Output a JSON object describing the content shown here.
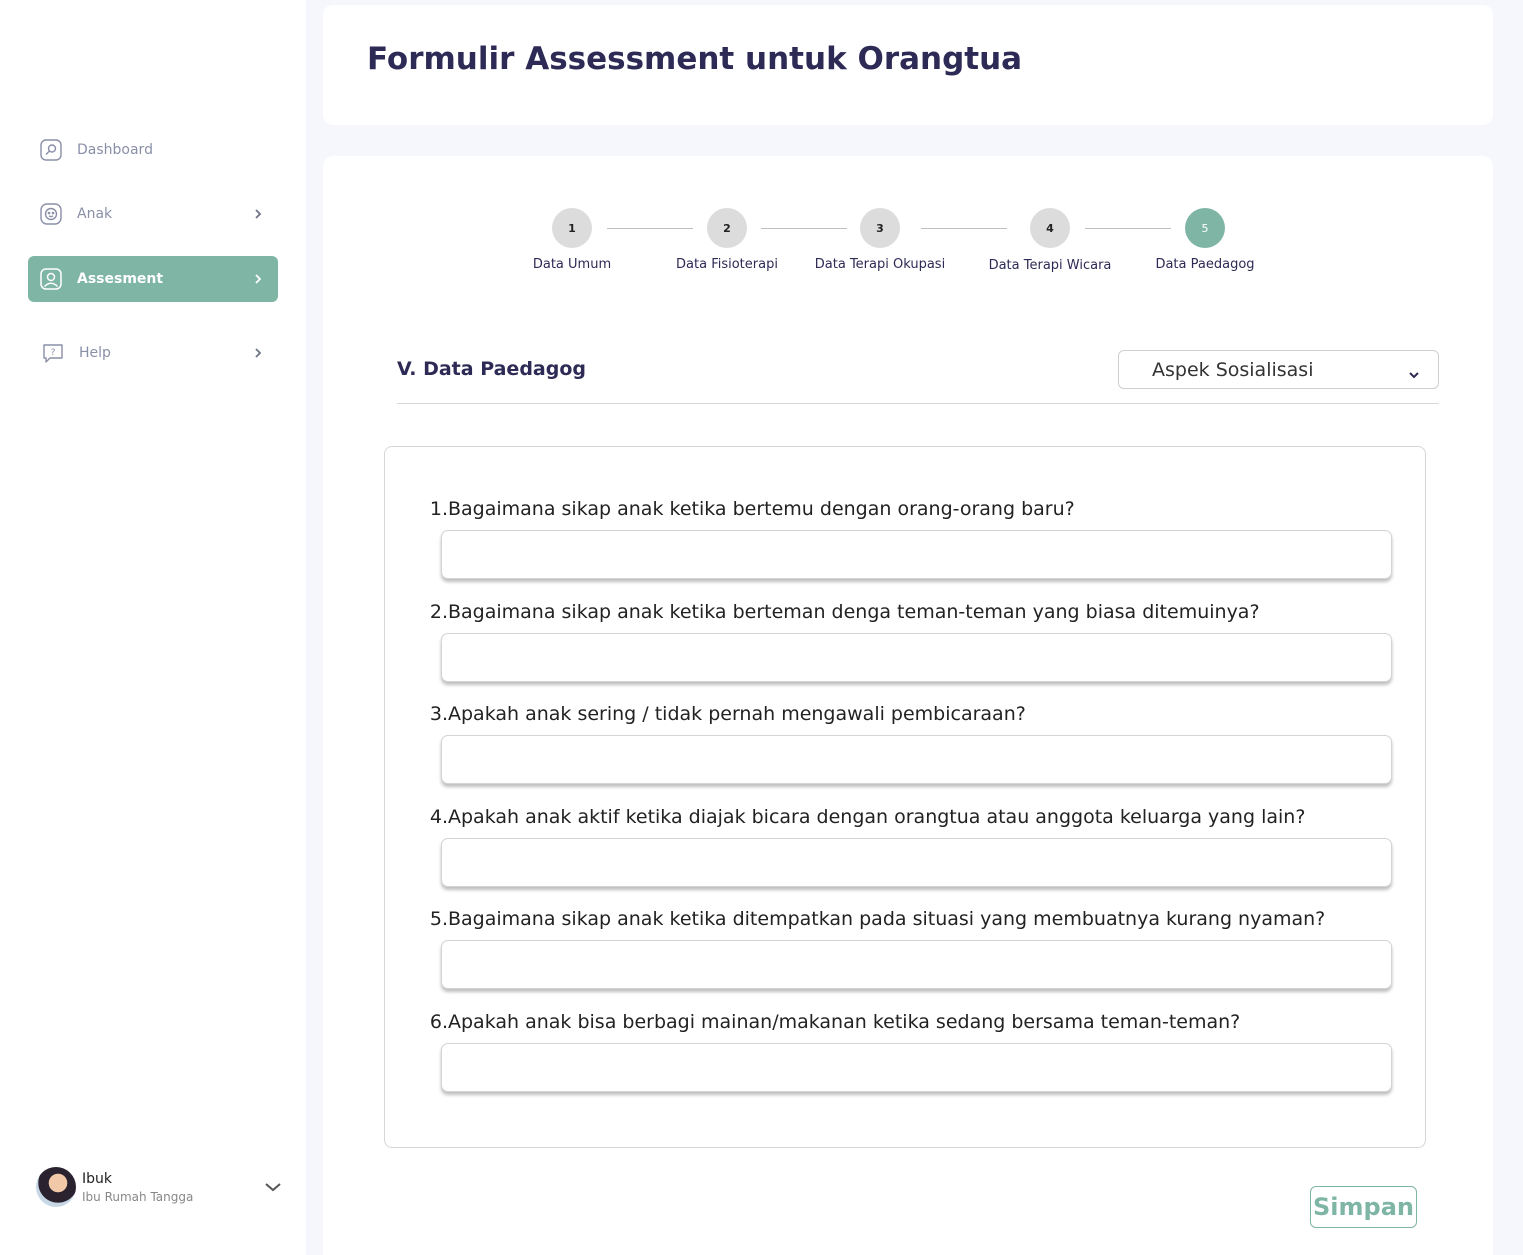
{
  "sidebar": {
    "items": [
      {
        "label": "Dashboard",
        "icon": "dashboard-icon"
      },
      {
        "label": "Anak",
        "icon": "child-face-icon"
      },
      {
        "label": "Assesment",
        "icon": "user-assessment-icon"
      },
      {
        "label": "Help",
        "icon": "help-icon"
      }
    ],
    "user": {
      "name": "Ibuk",
      "role": "Ibu Rumah Tangga"
    }
  },
  "header": {
    "title": "Formulir Assessment untuk Orangtua"
  },
  "stepper": {
    "steps": [
      {
        "number": "1",
        "label": "Data Umum"
      },
      {
        "number": "2",
        "label": "Data Fisioterapi"
      },
      {
        "number": "3",
        "label": "Data Terapi Okupasi"
      },
      {
        "number": "4",
        "label": "Data Terapi Wicara"
      },
      {
        "number": "5",
        "label": "Data Paedagog"
      }
    ],
    "active_step": 5
  },
  "section": {
    "title": "V. Data Paedagog",
    "aspect_select": {
      "selected": "Aspek Sosialisasi"
    }
  },
  "questions": [
    {
      "num": "1.",
      "text": "Bagaimana sikap anak ketika bertemu dengan orang-orang baru?",
      "value": ""
    },
    {
      "num": "2.",
      "text": "Bagaimana sikap anak ketika berteman denga teman-teman yang biasa ditemuinya?",
      "value": ""
    },
    {
      "num": "3.",
      "text": "Apakah anak sering / tidak pernah mengawali pembicaraan?",
      "value": ""
    },
    {
      "num": "4.",
      "text": "Apakah anak aktif ketika diajak bicara dengan orangtua atau anggota keluarga yang lain?",
      "value": ""
    },
    {
      "num": "5.",
      "text": "Bagaimana sikap anak ketika ditempatkan pada situasi yang membuatnya kurang nyaman?",
      "value": ""
    },
    {
      "num": "6.",
      "text": "Apakah anak bisa berbagi mainan/makanan ketika sedang bersama teman-teman?",
      "value": ""
    }
  ],
  "actions": {
    "save_label": "Simpan"
  },
  "colors": {
    "accent": "#7fb5a5",
    "title": "#2d2a55",
    "sidebar_text": "#8a8fa8"
  }
}
